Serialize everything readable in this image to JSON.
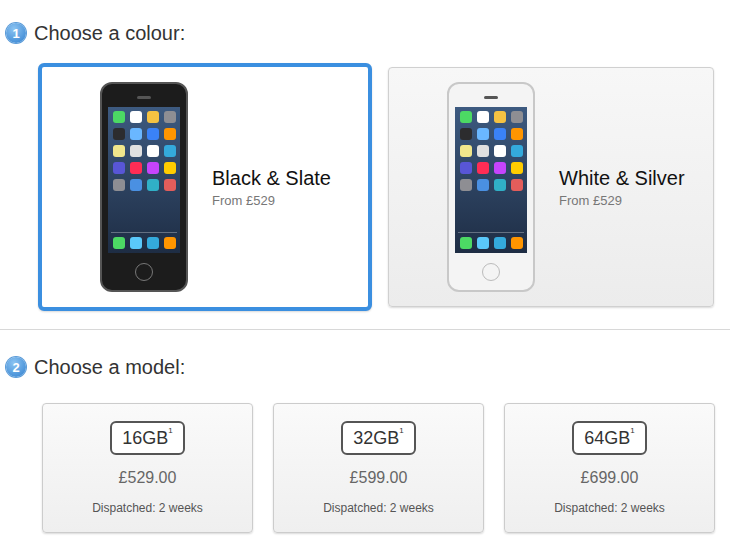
{
  "colour_step": {
    "number": "1",
    "title": "Choose a colour:",
    "options": [
      {
        "name": "Black & Slate",
        "price": "From £529",
        "selected": true,
        "color": "#1c1c1c"
      },
      {
        "name": "White & Silver",
        "price": "From £529",
        "selected": false,
        "color": "#f4f4f4"
      }
    ]
  },
  "model_step": {
    "number": "2",
    "title": "Choose a model:",
    "options": [
      {
        "capacity": "16GB",
        "footnote": "1",
        "price": "£529.00",
        "dispatch": "Dispatched: 2 weeks",
        "selected": false
      },
      {
        "capacity": "32GB",
        "footnote": "1",
        "price": "£599.00",
        "dispatch": "Dispatched: 2 weeks",
        "selected": false
      },
      {
        "capacity": "64GB",
        "footnote": "1",
        "price": "£699.00",
        "dispatch": "Dispatched: 2 weeks",
        "selected": false
      }
    ]
  }
}
